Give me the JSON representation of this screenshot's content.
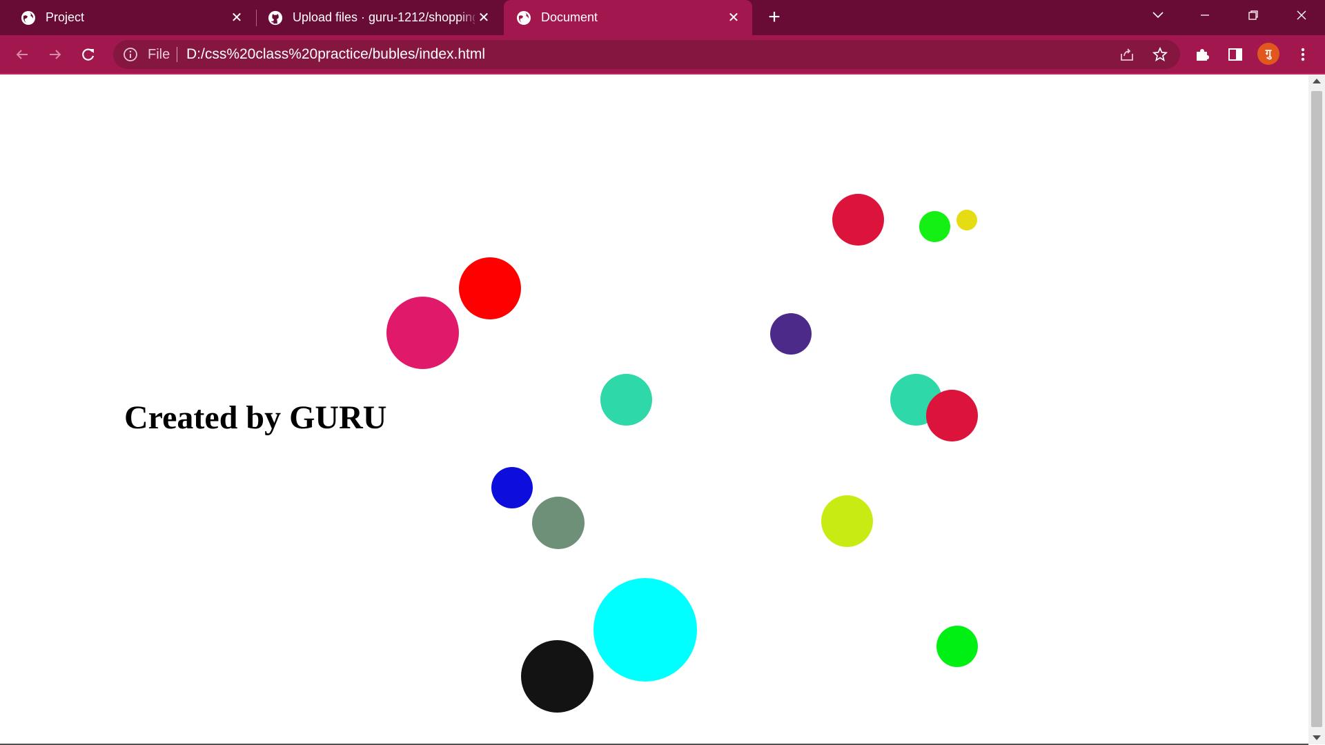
{
  "browser": {
    "tabs": [
      {
        "title": "Project",
        "icon": "globe-icon",
        "active": false
      },
      {
        "title": "Upload files · guru-1212/shopping",
        "icon": "github-icon",
        "active": false
      },
      {
        "title": "Document",
        "icon": "globe-icon",
        "active": true
      }
    ],
    "new_tab_label": "+",
    "address_bar": {
      "scheme_label": "File",
      "url": "D:/css%20class%20practice/bubles/index.html"
    },
    "profile_initial": "गु",
    "colors": {
      "tab_strip": "#680c35",
      "toolbar": "#a3174f",
      "omnibox": "#84163f"
    }
  },
  "page": {
    "heading": "Created by GURU",
    "bubbles": [
      {
        "color": "#dc143c"
      },
      {
        "color": "#14f014"
      },
      {
        "color": "#e5dc14"
      },
      {
        "color": "#ff0000"
      },
      {
        "color": "#e0196b"
      },
      {
        "color": "#4b2a8a"
      },
      {
        "color": "#2ed8a8"
      },
      {
        "color": "#2ed8a8"
      },
      {
        "color": "#dc143c"
      },
      {
        "color": "#0e0edc"
      },
      {
        "color": "#6e8f78"
      },
      {
        "color": "#c8eb14"
      },
      {
        "color": "#00ffff"
      },
      {
        "color": "#131313"
      },
      {
        "color": "#00f014"
      }
    ]
  }
}
